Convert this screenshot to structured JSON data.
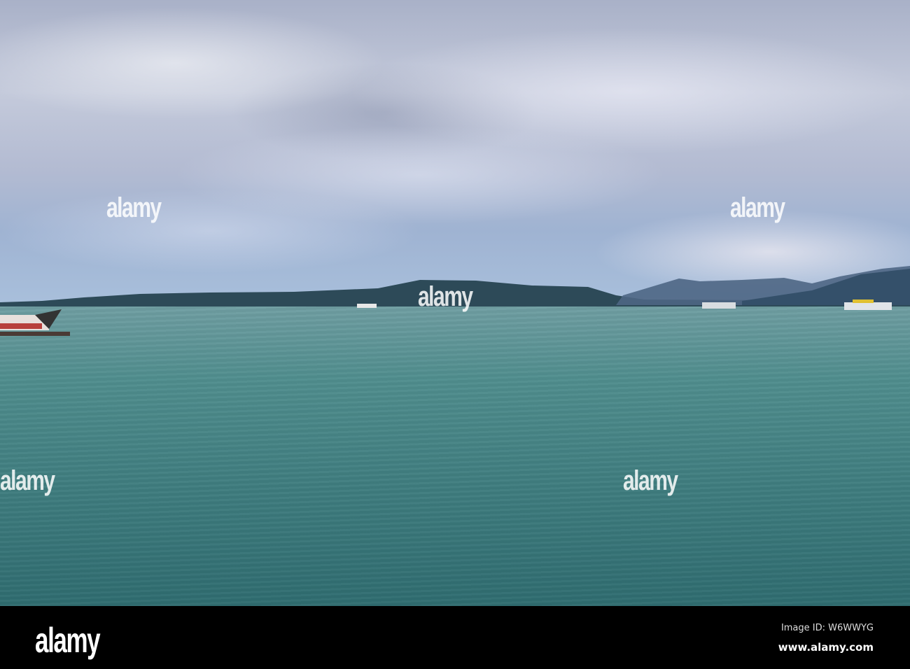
{
  "watermark": {
    "text": "alamy"
  },
  "footer": {
    "logo": "alamy",
    "image_id": "Image ID: W6WWYG",
    "url": "www.alamy.com"
  }
}
